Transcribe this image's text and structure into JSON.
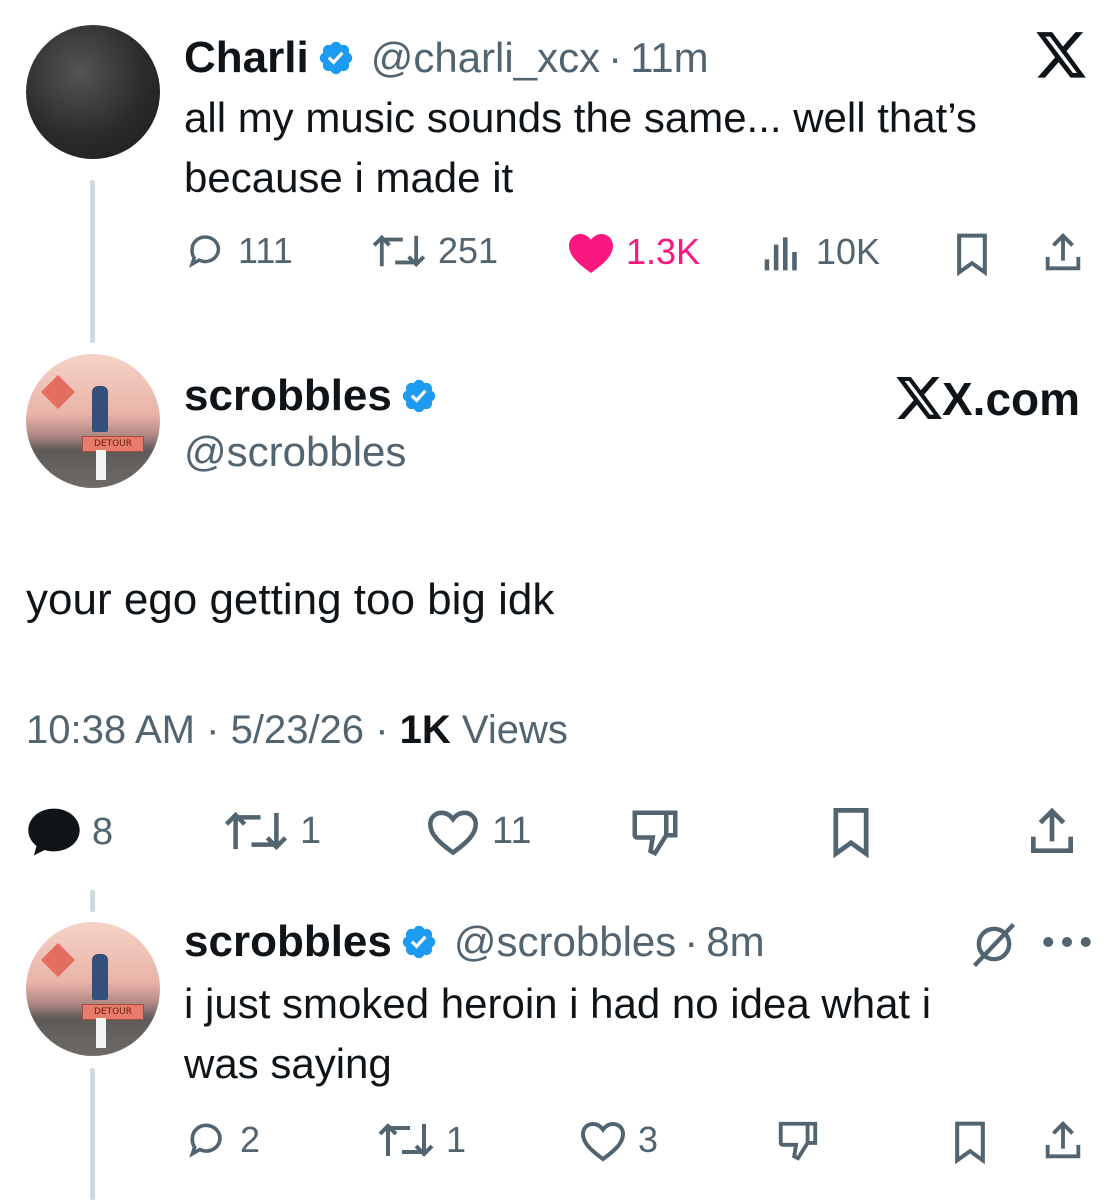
{
  "tweet1": {
    "name": "Charli",
    "handle": "@charli_xcx",
    "sep": "·",
    "time": "11m",
    "text_line1": "all my music sounds the same... well that’s",
    "text_line2": "because i made it",
    "replies": "111",
    "reposts": "251",
    "likes": "1.3K",
    "views": "10K"
  },
  "tweet2": {
    "name": "scrobbles",
    "handle": "@scrobbles",
    "site": "X.com",
    "text": "your ego getting too big idk",
    "time": "10:38 AM",
    "sep1": "·",
    "date": "5/23/26",
    "sep2": "·",
    "views_count": "1K",
    "views_label": "Views",
    "replies": "8",
    "reposts": "1",
    "likes": "11"
  },
  "tweet3": {
    "name": "scrobbles",
    "handle": "@scrobbles",
    "sep": "·",
    "time": "8m",
    "text_line1": "i just smoked heroin i had no idea what i",
    "text_line2": "was saying",
    "replies": "2",
    "reposts": "1",
    "likes": "3"
  },
  "avatar_text": "DETOUR",
  "colors": {
    "verified": "#1d9bf0",
    "like": "#f91880",
    "muted": "#536471",
    "thread": "#cfd9de"
  },
  "icons": [
    "x-logo-icon",
    "verified-icon",
    "reply-icon",
    "repost-icon",
    "heart-icon",
    "views-icon",
    "bookmark-icon",
    "share-icon",
    "dislike-icon",
    "grok-icon",
    "more-icon"
  ]
}
